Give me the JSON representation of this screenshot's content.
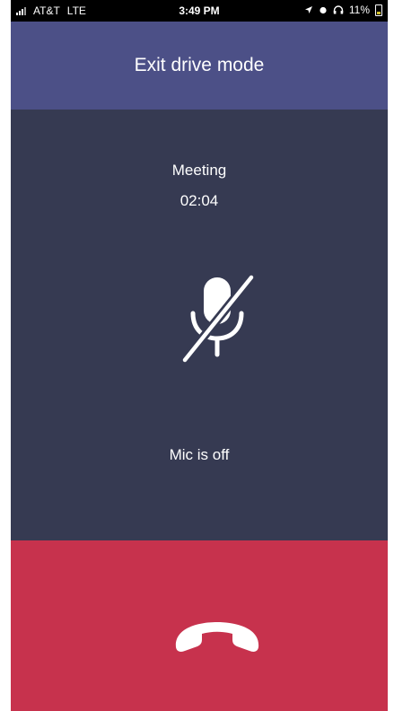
{
  "status_bar": {
    "carrier": "AT&T",
    "network": "LTE",
    "time": "3:49 PM",
    "battery": "11%"
  },
  "header": {
    "exit_label": "Exit drive mode"
  },
  "meeting": {
    "title": "Meeting",
    "duration": "02:04"
  },
  "mic": {
    "icon": "mic-off-icon",
    "status": "Mic is off"
  },
  "end_call": {
    "icon": "hang-up-icon"
  },
  "colors": {
    "header_bg": "#4c5087",
    "body_bg": "#363a52",
    "end_call_bg": "#c7324d"
  }
}
